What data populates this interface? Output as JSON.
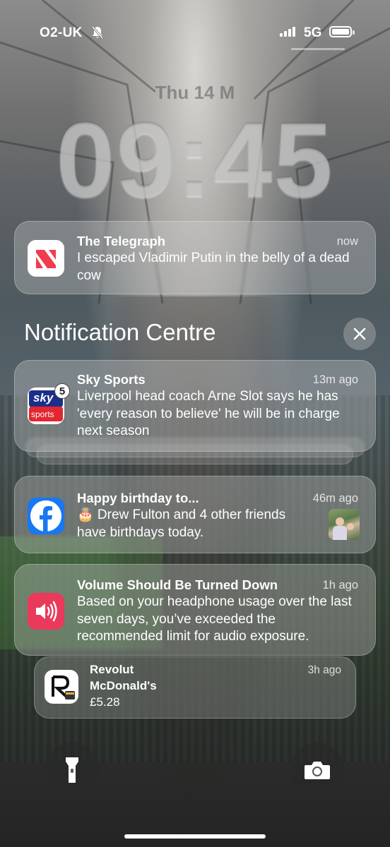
{
  "status_bar": {
    "carrier": "O2-UK",
    "network": "5G",
    "silent_mode": true,
    "signal_bars": 4
  },
  "lock_screen": {
    "date": "Thu 14 M",
    "time": "09:45"
  },
  "notifications": {
    "telegraph": {
      "app": "The Telegraph",
      "time": "now",
      "body": "I escaped Vladimir Putin in the belly of a dead cow",
      "icon": "news-icon"
    },
    "centre_title": "Notification Centre",
    "sky_sports": {
      "app": "Sky Sports",
      "time": "13m ago",
      "body": "Liverpool head coach Arne Slot says he has 'every reason to believe' he will be in charge next season",
      "badge": "5",
      "logo_top": "sky",
      "logo_bottom": "sports"
    },
    "facebook": {
      "app": "Happy birthday to...",
      "time": "46m ago",
      "body": "🎂 Drew Fulton and 4 other friends have birthdays today.",
      "icon": "facebook-icon"
    },
    "health": {
      "app": "Volume Should Be Turned Down",
      "time": "1h ago",
      "body": "Based on your headphone usage over the last seven days, you’ve exceeded the recommended limit for audio exposure.",
      "icon": "speaker-icon"
    },
    "revolut": {
      "app": "Revolut",
      "time": "3h ago",
      "line1": "McDonald's",
      "line2": "£5.28",
      "icon": "revolut-icon"
    }
  },
  "colors": {
    "sky_blue": "#1a2f8a",
    "sky_red": "#e3262f",
    "facebook_blue": "#1877f2",
    "health_red": "#ea3a5b",
    "news_red": "#f23b4d"
  }
}
